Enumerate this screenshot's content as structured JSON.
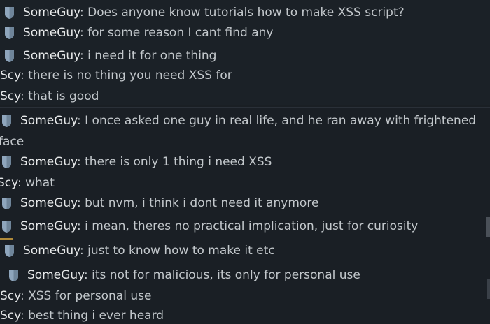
{
  "chat": {
    "lines": [
      {
        "name": "SomeGuy",
        "sep": ": ",
        "text": "Does anyone know tutorials how to make XSS script?",
        "shield": true
      },
      {
        "name": "SomeGuy",
        "sep": ": ",
        "text": "for some reason I cant find any",
        "shield": true
      },
      {
        "name": "SomeGuy",
        "sep": ": ",
        "text": "i need it for one thing",
        "shield": true
      },
      {
        "name": "Scy",
        "sep": ": ",
        "text": "there is no thing you need XSS for",
        "shield": false
      },
      {
        "name": "Scy",
        "sep": ": ",
        "text": "that is good",
        "shield": false
      },
      {
        "name": "SomeGuy",
        "sep": ": ",
        "text": "I once asked one guy in real life, and he ran away with frightened",
        "shield": true
      },
      {
        "name": "",
        "sep": "",
        "text": "face",
        "shield": false
      },
      {
        "name": "SomeGuy",
        "sep": ": ",
        "text": "there is only 1 thing i need XSS",
        "shield": true
      },
      {
        "name": "Scy",
        "sep": ": ",
        "text": "what",
        "shield": false
      },
      {
        "name": "SomeGuy",
        "sep": ": ",
        "text": "but nvm, i think i dont need it anymore",
        "shield": true
      },
      {
        "name": "SomeGuy",
        "sep": ": ",
        "text": "i mean, theres no practical implication, just for curiosity",
        "shield": true
      },
      {
        "name": "SomeGuy",
        "sep": ": ",
        "text": "just to know how to make it etc",
        "shield": true
      },
      {
        "name": "SomeGuy",
        "sep": ": ",
        "text": "its not for malicious, its only for personal use",
        "shield": true
      },
      {
        "name": "Scy",
        "sep": ": ",
        "text": "XSS for personal use",
        "shield": false
      },
      {
        "name": "Scy",
        "sep": ": ",
        "text": "best thing i ever heard",
        "shield": false
      }
    ]
  },
  "colors": {
    "background": "#1a1f24",
    "name": "#e7e9ea",
    "message": "#c3c8cc",
    "shield": "#8fa6bd"
  },
  "icons": {
    "rank": "shield-icon"
  }
}
